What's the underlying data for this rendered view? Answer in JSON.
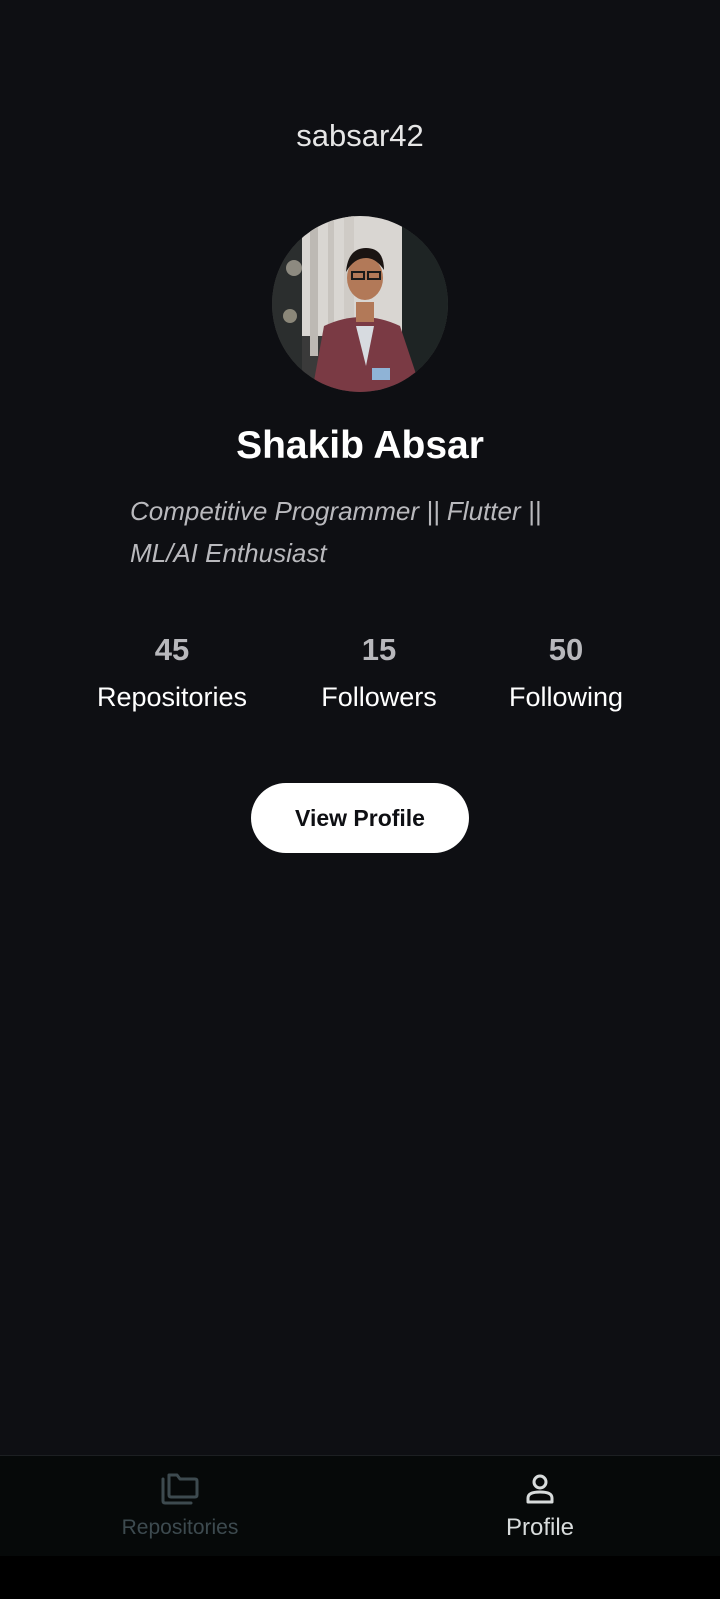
{
  "header": {
    "username": "sabsar42"
  },
  "profile": {
    "full_name": "Shakib Absar",
    "bio": "Competitive Programmer || Flutter || ML/AI Enthusiast"
  },
  "stats": {
    "repositories": {
      "value": "45",
      "label": "Repositories"
    },
    "followers": {
      "value": "15",
      "label": "Followers"
    },
    "following": {
      "value": "50",
      "label": "Following"
    }
  },
  "actions": {
    "view_profile_label": "View Profile"
  },
  "bottom_nav": {
    "items": [
      {
        "label": "Repositories",
        "icon": "folders-icon",
        "active": false
      },
      {
        "label": "Profile",
        "icon": "person-icon",
        "active": true
      }
    ]
  },
  "colors": {
    "background": "#0e0f13",
    "nav_background": "#060909",
    "inactive_nav": "#3d4a4f",
    "active_nav": "#d8dcdc",
    "button_bg": "#ffffff"
  }
}
